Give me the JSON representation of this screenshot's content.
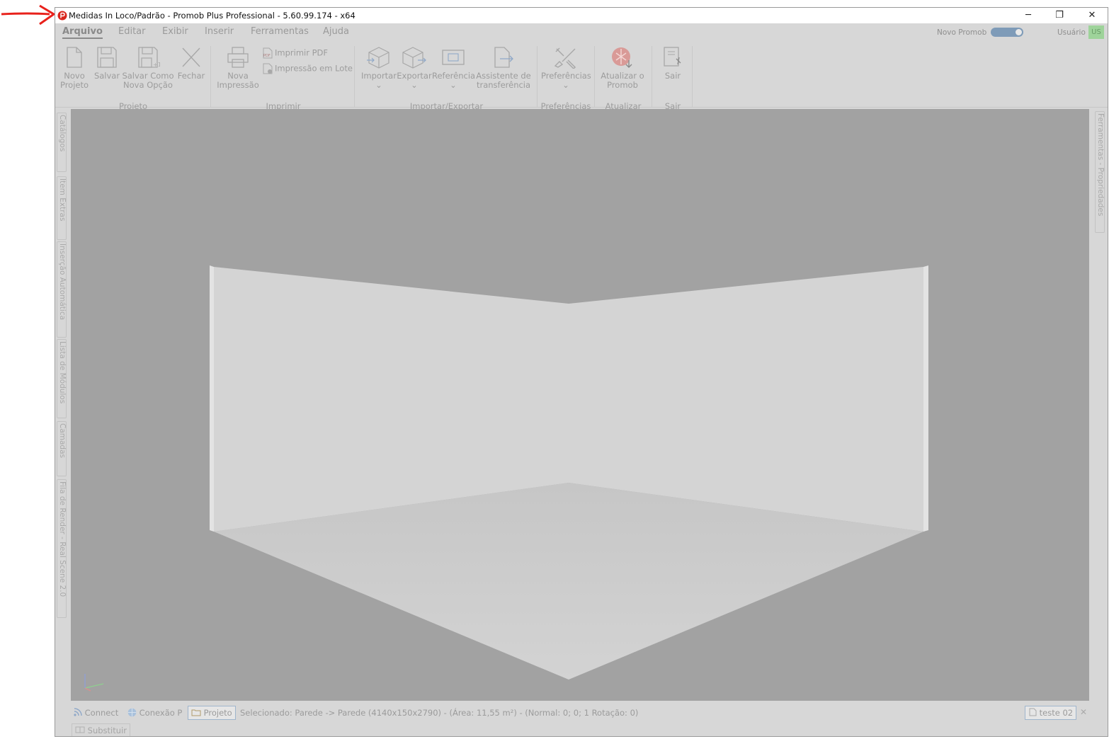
{
  "window": {
    "title": "Medidas In Loco/Padrão - Promob Plus Professional - 5.60.99.174 - x64",
    "minimize": "─",
    "restore": "❐",
    "close": "✕"
  },
  "menu": {
    "items": [
      "Arquivo",
      "Editar",
      "Exibir",
      "Inserir",
      "Ferramentas",
      "Ajuda"
    ],
    "active": "Arquivo"
  },
  "topright": {
    "novo_promob_label": "Novo Promob",
    "novo_promob_enabled": true,
    "user_label": "Usuário",
    "user_badge": "US"
  },
  "ribbon": {
    "projeto": {
      "label": "Projeto",
      "novo_line1": "Novo",
      "novo_line2": "Projeto",
      "salvar": "Salvar",
      "salvar_como_line1": "Salvar Como",
      "salvar_como_line2": "Nova Opção",
      "fechar": "Fechar"
    },
    "imprimir": {
      "label": "Imprimir",
      "nova_line1": "Nova",
      "nova_line2": "Impressão",
      "pdf": "Imprimir PDF",
      "lote": "Impressão em Lote"
    },
    "importar_exportar": {
      "label": "Importar/Exportar",
      "importar": "Importar",
      "exportar": "Exportar",
      "referencia": "Referência",
      "assistente_line1": "Assistente de",
      "assistente_line2": "transferência",
      "dropdown_glyph": "⌄"
    },
    "preferencias": {
      "label": "Preferências",
      "button": "Preferências"
    },
    "atualizar": {
      "label": "Atualizar",
      "line1": "Atualizar o",
      "line2": "Promob"
    },
    "sair": {
      "label": "Sair",
      "button": "Sair"
    }
  },
  "left_panels": [
    "Catálogos",
    "Item Extras",
    "Inserção Automática",
    "Lista de Módulos",
    "Camadas",
    "Fila de Render - Real Scene 2.0"
  ],
  "right_panels": [
    "Ferramentas - Propriedades"
  ],
  "statusbar": {
    "connect": "Connect",
    "conexao": "Conexão P",
    "projeto": "Projeto",
    "selection": "Selecionado: Parede -> Parede (4140x150x2790) - (Área: 11,55 m²) - (Normal: 0; 0; 1 Rotação: 0)",
    "project_tab": "teste 02",
    "close": "✕"
  },
  "substituir": "Substituir",
  "colors": {
    "viewport_bg": "#a2a2a2",
    "wall": "#d4d4d4",
    "floor": "#cfcfcf",
    "arrow": "#e8211b",
    "toggle": "#7e9bb8",
    "user_badge": "#9ed39a"
  }
}
